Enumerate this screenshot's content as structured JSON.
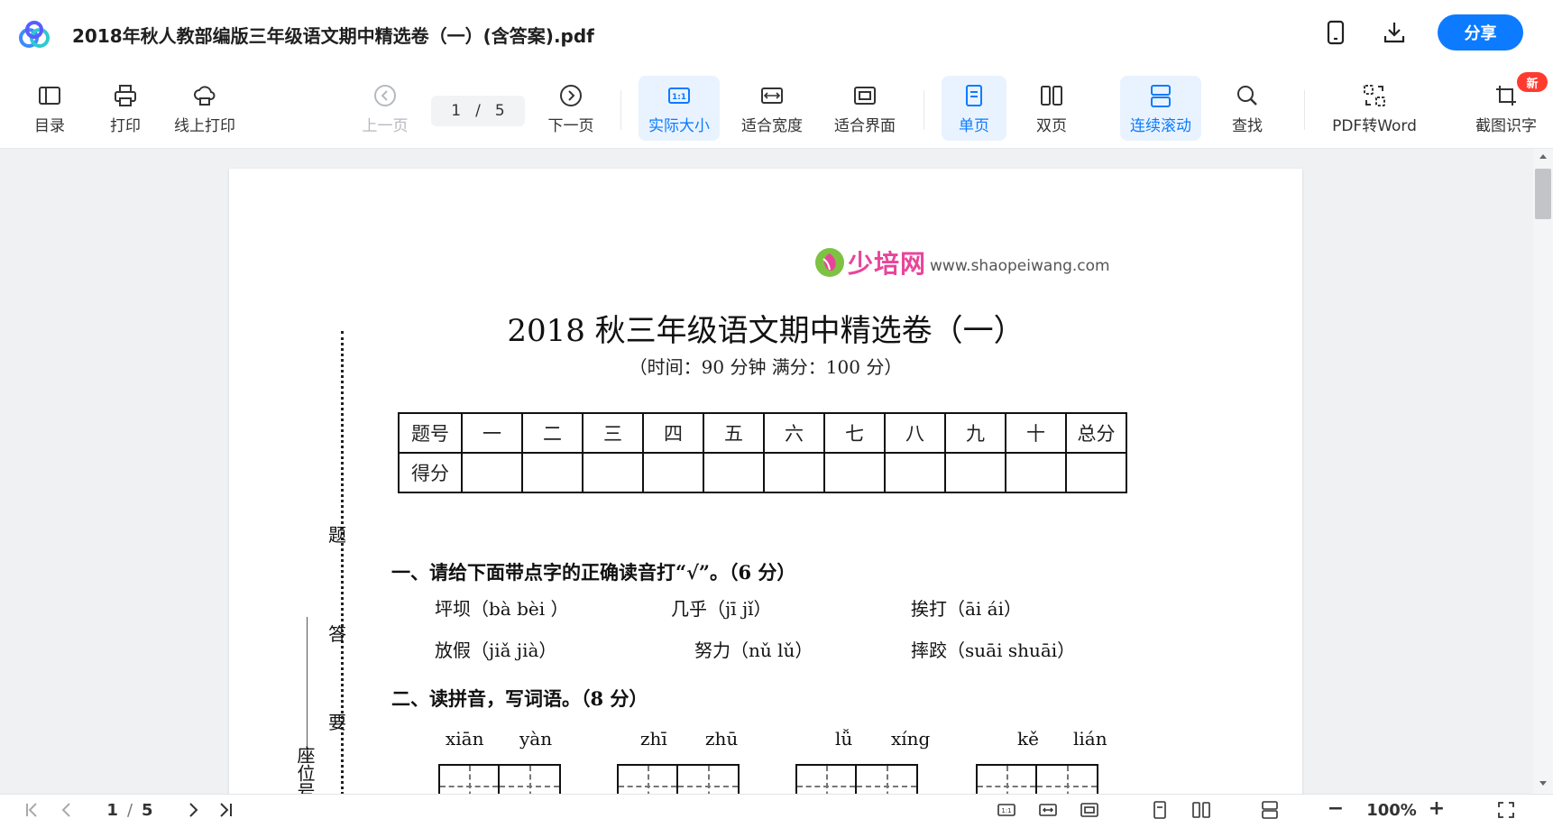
{
  "header": {
    "title": "2018年秋人教部编版三年级语文期中精选卷（一）(含答案).pdf",
    "share_label": "分享"
  },
  "toolbar": {
    "toc": "目录",
    "print": "打印",
    "online_print": "线上打印",
    "prev_page": "上一页",
    "current_page": "1",
    "page_sep": "/",
    "total_pages": "5",
    "next_page": "下一页",
    "actual_size": "实际大小",
    "fit_width": "适合宽度",
    "fit_screen": "适合界面",
    "single_page": "单页",
    "double_page": "双页",
    "continuous_scroll": "连续滚动",
    "find": "查找",
    "pdf_to_word": "PDF转Word",
    "screenshot_ocr": "截图识字",
    "new_badge": "新"
  },
  "document": {
    "brand_cn": "少培网",
    "brand_url": "www.shaopeiwang.com",
    "exam_title": "2018 秋三年级语文期中精选卷（一）",
    "exam_subtitle": "（时间：90 分钟   满分：100 分）",
    "score_table": {
      "row1": [
        "题号",
        "一",
        "二",
        "三",
        "四",
        "五",
        "六",
        "七",
        "八",
        "九",
        "十",
        "总分"
      ],
      "row2_label": "得分"
    },
    "side_text": [
      "题",
      "答",
      "要"
    ],
    "seat_label": "座位号",
    "q1_title": "一、请给下面带点字的正确读音打“√”。（6 分）",
    "q1_items": [
      "坪坝（bà  bèi ）",
      "几乎（jī  jǐ）",
      "挨打（āi  ái）",
      "放假（jiǎ  jià）",
      "努力（nǔ  lǔ）",
      "摔跤（suāi  shuāi）"
    ],
    "q2_title": "二、读拼音，写词语。（8 分）",
    "q2_pinyin": [
      "xiān",
      "yàn",
      "zhī",
      "zhū",
      "lǚ",
      "xíng",
      "kě",
      "lián"
    ]
  },
  "bottombar": {
    "current_page": "1",
    "page_sep": "/",
    "total_pages": "5",
    "zoom": "100%",
    "zoom_minus": "−",
    "zoom_plus": "+"
  },
  "colors": {
    "accent": "#0c7bff",
    "active_bg": "#e9f3ff",
    "badge": "#ff3b30"
  }
}
